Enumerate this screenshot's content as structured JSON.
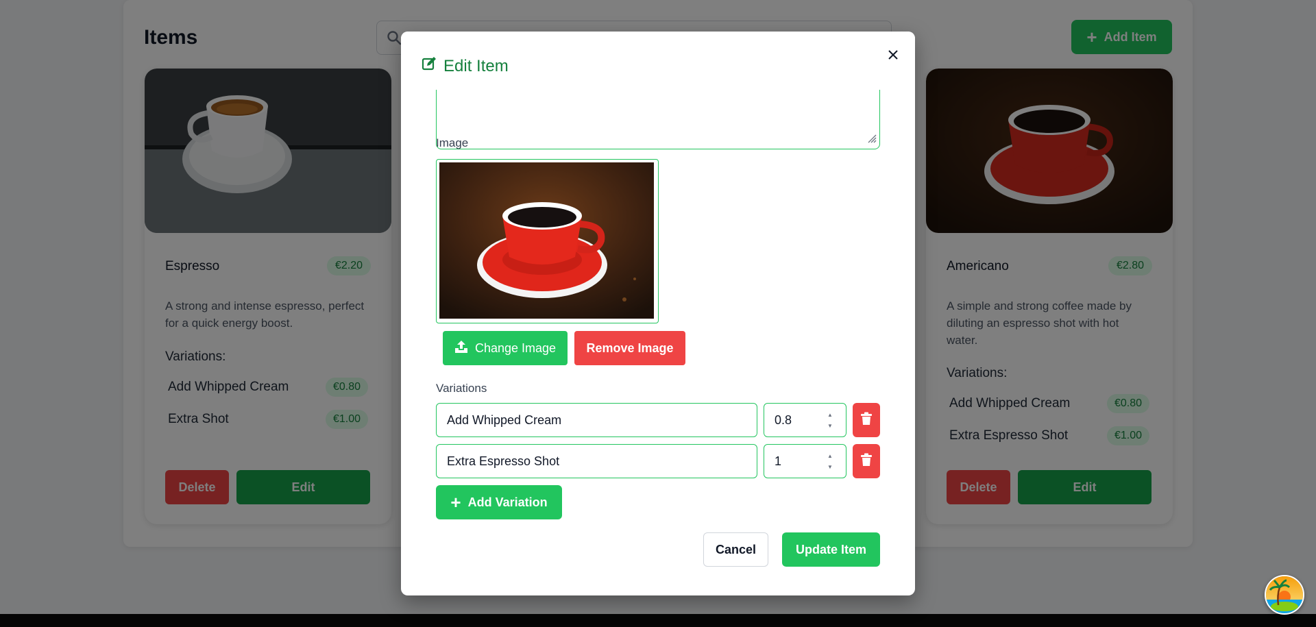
{
  "page": {
    "title": "Items",
    "add_item_label": "Add Item"
  },
  "cards": [
    {
      "name": "Espresso",
      "price": "€2.20",
      "description": "A strong and intense espresso, perfect for a quick energy boost.",
      "variations_title": "Variations:",
      "variations": [
        {
          "name": "Add Whipped Cream",
          "price": "€0.80"
        },
        {
          "name": "Extra Shot",
          "price": "€1.00"
        }
      ],
      "delete_label": "Delete",
      "edit_label": "Edit"
    },
    {
      "name": "Americano",
      "price": "€2.80",
      "description": "A simple and strong coffee made by diluting an espresso shot with hot water.",
      "variations_title": "Variations:",
      "variations": [
        {
          "name": "Add Whipped Cream",
          "price": "€0.80"
        },
        {
          "name": "Extra Espresso Shot",
          "price": "€1.00"
        }
      ],
      "delete_label": "Delete",
      "edit_label": "Edit"
    }
  ],
  "modal": {
    "title": "Edit Item",
    "close_icon": "close-icon",
    "image_label": "Image",
    "change_image_label": "Change Image",
    "remove_image_label": "Remove Image",
    "variations_label": "Variations",
    "variations": [
      {
        "name": "Add Whipped Cream",
        "price": "0.8"
      },
      {
        "name": "Extra Espresso Shot",
        "price": "1"
      }
    ],
    "add_variation_label": "Add Variation",
    "cancel_label": "Cancel",
    "update_label": "Update Item"
  },
  "colors": {
    "accent_green": "#22c55e",
    "title_green": "#15803d",
    "danger_red": "#ef4444"
  }
}
